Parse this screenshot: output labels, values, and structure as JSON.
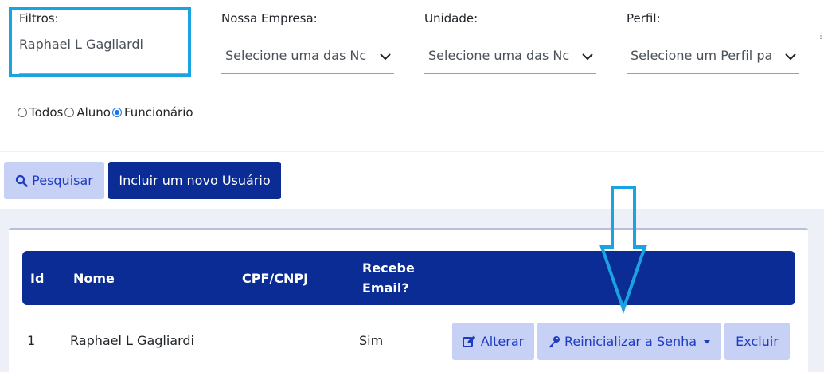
{
  "filters": {
    "filtros": {
      "label": "Filtros:",
      "value": "Raphael L Gagliardi"
    },
    "empresa": {
      "label": "Nossa Empresa:",
      "value": "Selecione uma das Nc"
    },
    "unidade": {
      "label": "Unidade:",
      "value": "Selecione uma das Nc"
    },
    "perfil": {
      "label": "Perfil:",
      "value": "Selecione um Perfil pa"
    }
  },
  "radios": [
    {
      "label": "Todos",
      "checked": false
    },
    {
      "label": "Aluno",
      "checked": false
    },
    {
      "label": "Funcionário",
      "checked": true
    }
  ],
  "buttons": {
    "search": "Pesquisar",
    "new_user": "Incluir um novo Usuário"
  },
  "table": {
    "headers": {
      "id": "Id",
      "nome": "Nome",
      "cpf": "CPF/CNPJ",
      "email_line1": "Recebe",
      "email_line2": "Email?"
    },
    "rows": [
      {
        "id": "1",
        "nome": "Raphael L Gagliardi",
        "cpf": "",
        "email": "Sim"
      }
    ],
    "actions": {
      "alterar": "Alterar",
      "reset": "Reinicializar a Senha",
      "excluir": "Excluir"
    }
  },
  "colors": {
    "primary": "#0b2c94",
    "light_button": "#c7d0f5",
    "highlight": "#1aa3e0"
  },
  "icons": [
    "search-icon",
    "edit-icon",
    "key-icon",
    "caret-down-icon",
    "chevron-down-icon",
    "down-arrow-annotation"
  ]
}
